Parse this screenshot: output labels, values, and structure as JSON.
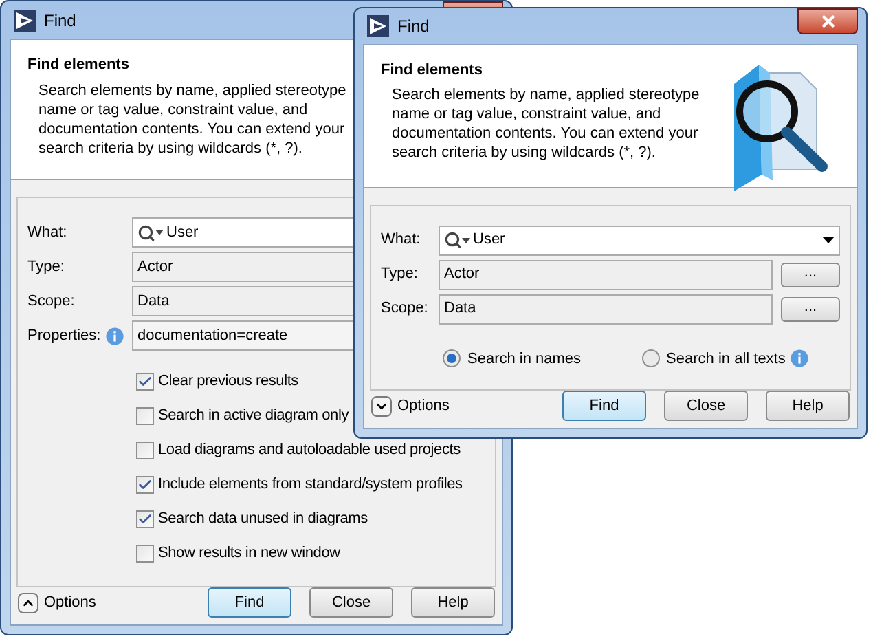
{
  "windows": [
    {
      "title": "Find",
      "header": {
        "title": "Find elements",
        "description": "Search elements by name, applied stereotype name or tag value, constraint value, and documentation contents. You can extend your search criteria by using wildcards (*, ?)."
      },
      "fields": [
        {
          "kind": "combo",
          "label": "What:",
          "value": "User"
        },
        {
          "kind": "readonly",
          "label": "Type:",
          "value": "Actor"
        },
        {
          "kind": "readonly",
          "label": "Scope:",
          "value": "Data"
        },
        {
          "kind": "text",
          "label": "Properties:",
          "info": true,
          "value": "documentation=create"
        }
      ],
      "checkboxes": [
        {
          "label": "Clear previous results",
          "checked": true
        },
        {
          "label": "Search in active diagram only",
          "checked": false
        },
        {
          "label": "Load diagrams and autoloadable used projects",
          "checked": false
        },
        {
          "label": "Include elements from standard/system profiles",
          "checked": true
        },
        {
          "label": "Search data unused in diagrams",
          "checked": true
        },
        {
          "label": "Show results in new window",
          "checked": false
        }
      ],
      "options_toggle": {
        "label": "Options",
        "expanded": true
      },
      "buttons": [
        {
          "label": "Find",
          "default": true
        },
        {
          "label": "Close",
          "default": false
        },
        {
          "label": "Help",
          "default": false
        }
      ]
    },
    {
      "title": "Find",
      "header": {
        "title": "Find elements",
        "description": "Search elements by name, applied stereotype name or tag value, constraint value, and documentation contents. You can extend your search criteria by using wildcards (*, ?)."
      },
      "fields": [
        {
          "kind": "combo",
          "label": "What:",
          "value": "User"
        },
        {
          "kind": "readonly",
          "label": "Type:",
          "value": "Actor",
          "browse": "..."
        },
        {
          "kind": "readonly",
          "label": "Scope:",
          "value": "Data",
          "browse": "..."
        }
      ],
      "search_modes": [
        {
          "label": "Search in names",
          "selected": true,
          "info": false
        },
        {
          "label": "Search in all texts",
          "selected": false,
          "info": true
        }
      ],
      "options_toggle": {
        "label": "Options",
        "expanded": false
      },
      "buttons": [
        {
          "label": "Find",
          "default": true
        },
        {
          "label": "Close",
          "default": false
        },
        {
          "label": "Help",
          "default": false
        }
      ]
    }
  ]
}
